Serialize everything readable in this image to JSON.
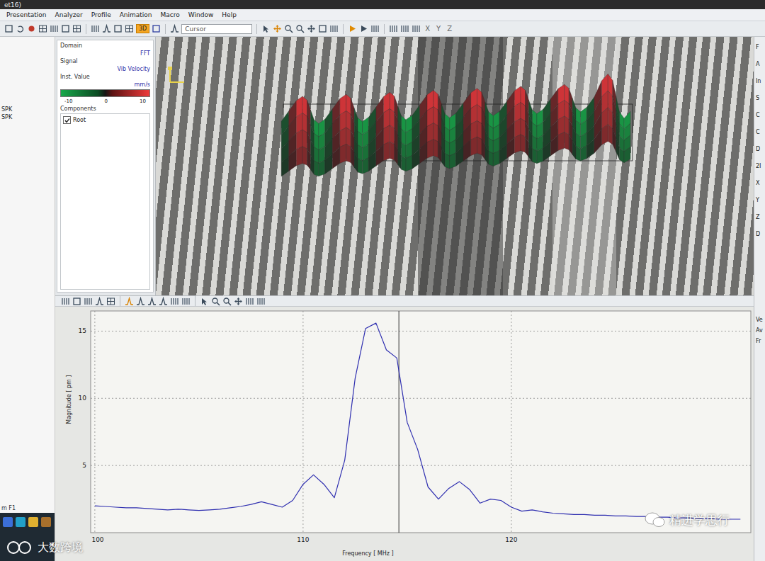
{
  "window": {
    "title": "et16)"
  },
  "menu": [
    "Presentation",
    "Analyzer",
    "Profile",
    "Animation",
    "Macro",
    "Window",
    "Help"
  ],
  "toolbar": {
    "cursor_field": "Cursor",
    "view_button": "3D",
    "axes": [
      "X",
      "Y",
      "Z"
    ]
  },
  "left_pane": {
    "items": [
      "SPK",
      "SPK"
    ],
    "footer": "m F1"
  },
  "properties": {
    "domain_label": "Domain",
    "domain_value": "FFT",
    "signal_label": "Signal",
    "signal_value": "Vib Velocity",
    "inst_label": "Inst. Value",
    "unit": "mm/s",
    "colorbar_ticks": [
      "-10",
      "0",
      "10"
    ],
    "components_label": "Components",
    "components": [
      {
        "label": "Root",
        "checked": true
      }
    ]
  },
  "right_pane": {
    "top": [
      "F",
      "A",
      "In",
      "S",
      "C",
      "C",
      "D",
      "2I",
      "X",
      "Y",
      "Z",
      "D"
    ],
    "bottom": [
      "Ve",
      "Av",
      "Fr"
    ]
  },
  "chart": {
    "y_label": "Magnitude [ pm ]",
    "x_label": "Frequency [ MHz ]",
    "y_ticks": [
      "5",
      "10",
      "15"
    ],
    "x_ticks": [
      "100",
      "110",
      "120"
    ],
    "x_min": 99.8,
    "x_max": 131.5,
    "y_min": 0,
    "y_max": 16.5,
    "cursor_mhz": 114.6,
    "series": [
      {
        "x_start": 100,
        "x_step": 0.5,
        "values": [
          2.0,
          1.95,
          1.9,
          1.85,
          1.85,
          1.8,
          1.75,
          1.7,
          1.75,
          1.7,
          1.65,
          1.7,
          1.75,
          1.85,
          1.95,
          2.1,
          2.3,
          2.1,
          1.9,
          2.4,
          3.6,
          4.3,
          3.6,
          2.6,
          5.4,
          11.5,
          15.2,
          15.6,
          13.6,
          13.0,
          8.2,
          6.2,
          3.4,
          2.5,
          3.3,
          3.8,
          3.2,
          2.2,
          2.5,
          2.4,
          1.9,
          1.6,
          1.7,
          1.55,
          1.45,
          1.4,
          1.35,
          1.35,
          1.3,
          1.3,
          1.25,
          1.25,
          1.2,
          1.2,
          1.15,
          1.15,
          1.1,
          1.1,
          1.05,
          1.05,
          1.0,
          1.0,
          1.0
        ]
      }
    ]
  },
  "watermarks": [
    "精进学思行",
    "大数跨境"
  ]
}
